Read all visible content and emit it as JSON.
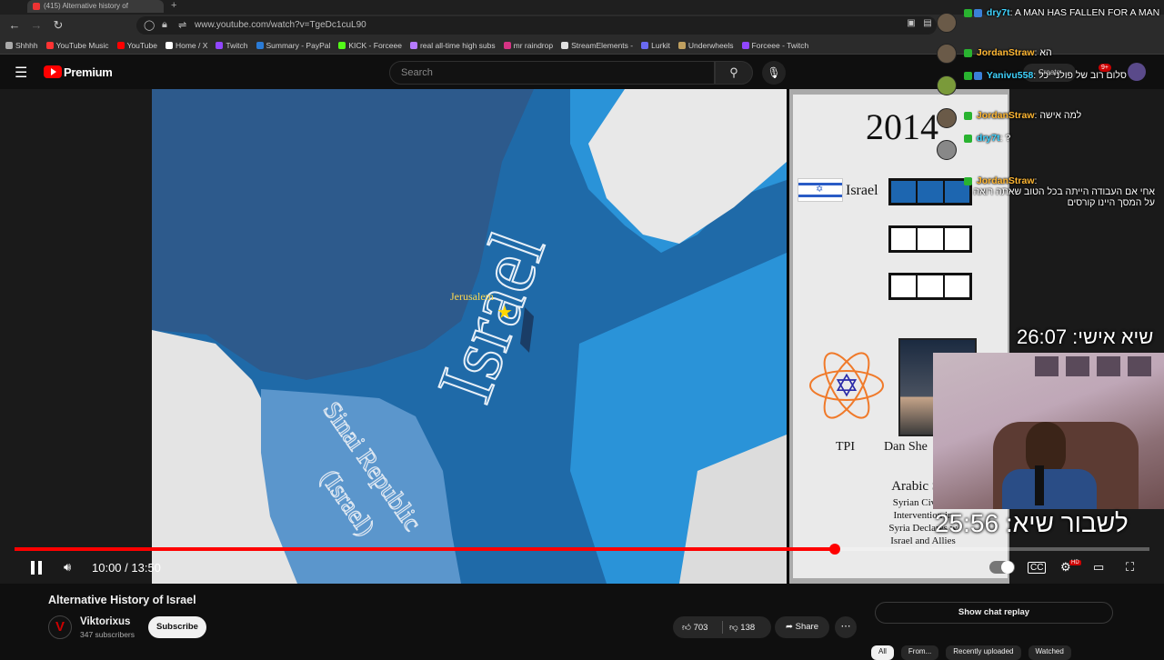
{
  "browser": {
    "tab_title": "(415) Alternative history of",
    "url": "www.youtube.com/watch?v=TgeDc1cuL90",
    "bookmarks": [
      "Shhhh",
      "YouTube Music",
      "YouTube",
      "Home / X",
      "Twitch",
      "Summary - PayPal",
      "KICK - Forceee",
      "real all-time high subs",
      "mr raindrop",
      "StreamElements -",
      "Lurkit",
      "Underwheels",
      "Forceee - Twitch"
    ],
    "bookmark_colors": [
      "#aaaaaa",
      "#ff3333",
      "#ff0000",
      "#ffffff",
      "#9146ff",
      "#2a7bd6",
      "#53fc18",
      "#b57aff",
      "#d63384",
      "#e0e0e0",
      "#6a6af2",
      "#c0a060",
      "#9146ff"
    ]
  },
  "youtube": {
    "logo_text": "Premium",
    "search_placeholder": "Search",
    "create_label": "Create",
    "notif_count": "9+"
  },
  "video": {
    "map": {
      "country_label": "Israel",
      "capital_label": "Jerusalem",
      "region_label_1": "Sinai Republic",
      "region_label_2": "(Israel)"
    },
    "panel": {
      "year": "2014",
      "country": "Israel",
      "leader_org": "TPI",
      "leader_name": "Dan She",
      "event_heading": "Arabic Spri",
      "events": [
        "Syrian Civil W",
        "Intervention in",
        "Syria Declares w",
        "Israel and Allies"
      ]
    }
  },
  "chat": [
    {
      "user": "dry7t",
      "message": "A MAN HAS FALLEN FOR A MAN",
      "user_color": "#3fd3ff"
    },
    {
      "user": "JordanStraw",
      "message": "הא",
      "user_color": "#ffb733"
    },
    {
      "user": "Yanivu558",
      "message": "סלום רוב של פולני יכל",
      "user_color": "#3fd3ff"
    },
    {
      "user": "JordanStraw",
      "message": "למה אישה",
      "user_color": "#ffb733"
    },
    {
      "user": "dry7t",
      "message": "?",
      "user_color": "#3fd3ff"
    },
    {
      "user": "JordanStraw",
      "message": "אחי אם העבודה הייתה בכל הטוב שאתה רואה על המסך היינו קורסים",
      "user_color": "#ffb733"
    }
  ],
  "overlay": {
    "timer_top": "שיא אישי: 26:07",
    "timer_bottom": "לשבור שיא: 25:56"
  },
  "player": {
    "time_display": "10:00 / 13:50",
    "progress_fraction": 0.7224,
    "hd_badge": "HD"
  },
  "meta": {
    "title": "Alternative History of Israel",
    "channel": "Viktorixus",
    "subscribers": "347 subscribers",
    "subscribe_label": "Subscribe",
    "likes": "703",
    "dislikes": "138",
    "share_label": "Share",
    "chat_replay_label": "Show chat replay",
    "chips": [
      "All",
      "From...",
      "Recently uploaded",
      "Watched"
    ]
  }
}
